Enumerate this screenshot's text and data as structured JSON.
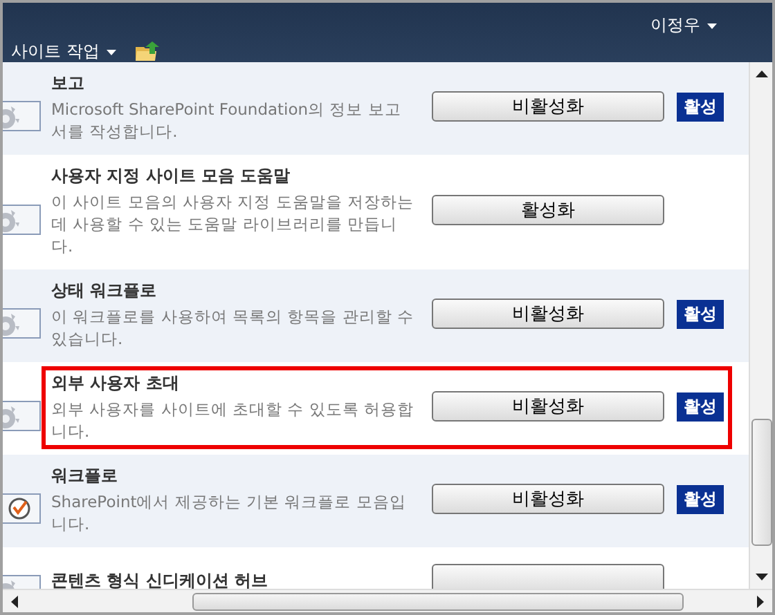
{
  "header": {
    "user": "이정우",
    "site_actions": "사이트 작업"
  },
  "features": [
    {
      "kind": "gear",
      "title": "보고",
      "description": "Microsoft SharePoint Foundation의 정보 보고서를 작성합니다.",
      "button": "비활성화",
      "status": "활성",
      "highlighted": false
    },
    {
      "kind": "gear",
      "title": "사용자 지정 사이트 모음 도움말",
      "description": "이 사이트 모음의 사용자 지정 도움말을 저장하는 데 사용할 수 있는 도움말 라이브러리를 만듭니다.",
      "button": "활성화",
      "highlighted": false
    },
    {
      "kind": "gear",
      "title": "상태 워크플로",
      "description": "이 워크플로를 사용하여 목록의 항목을 관리할 수 있습니다.",
      "button": "비활성화",
      "status": "활성",
      "highlighted": false
    },
    {
      "kind": "gear",
      "title": "외부 사용자 초대",
      "description": "외부 사용자를 사이트에 초대할 수 있도록 허용합니다.",
      "button": "비활성화",
      "status": "활성",
      "highlighted": true
    },
    {
      "kind": "workflow",
      "title": "워크플로",
      "description": "SharePoint에서 제공하는 기본 워크플로 모음입니다.",
      "button": "비활성화",
      "status": "활성",
      "highlighted": false
    },
    {
      "kind": "gear",
      "title": "콘텐츠 형식 신디케이션 허브",
      "highlighted": false
    }
  ]
}
